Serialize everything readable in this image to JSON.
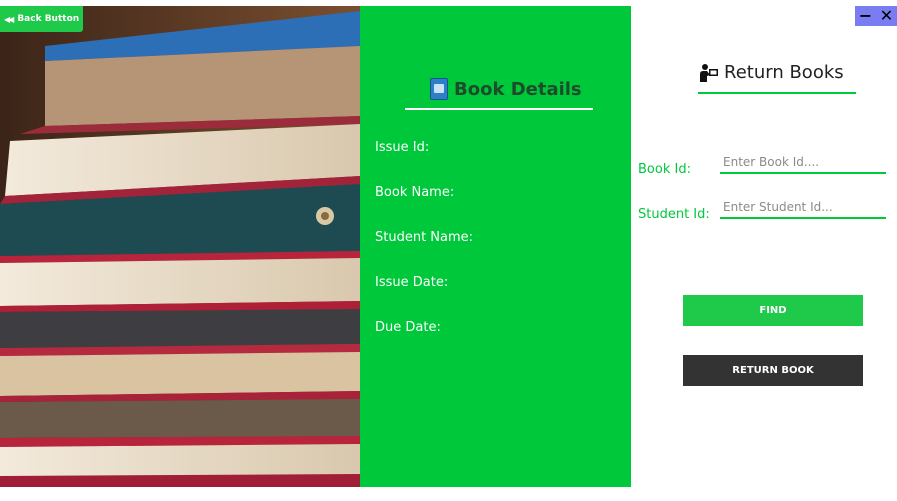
{
  "header": {
    "back_label": "Back Button",
    "minimize_label": "−",
    "close_label": "✕"
  },
  "details": {
    "title": "Book Details",
    "labels": [
      "Issue Id:",
      "Book Name:",
      "Student Name:",
      "Issue Date:",
      "Due Date:"
    ]
  },
  "return_books": {
    "title": "Return Books",
    "book_id_label": "Book Id:",
    "book_id_placeholder": "Enter Book Id....",
    "student_id_label": "Student Id:",
    "student_id_placeholder": "Enter Student Id...",
    "find_label": "FIND",
    "return_label": "RETURN BOOK"
  },
  "colors": {
    "accent_green": "#00c83b",
    "button_green": "#1fc94a",
    "button_dark": "#333333",
    "window_controls": "#7a7cf2"
  }
}
